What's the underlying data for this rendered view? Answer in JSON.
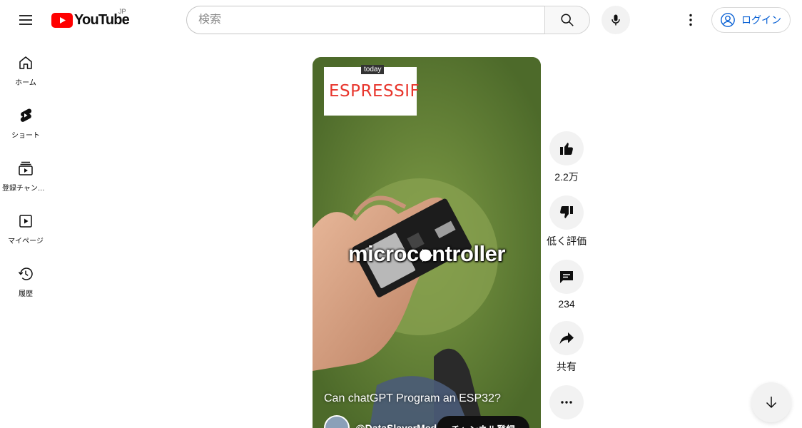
{
  "header": {
    "logo_text": "YouTube",
    "region": "JP",
    "search_placeholder": "検索",
    "login_label": "ログイン"
  },
  "sidebar": {
    "items": [
      {
        "label": "ホーム",
        "icon": "home-icon"
      },
      {
        "label": "ショート",
        "icon": "shorts-icon"
      },
      {
        "label": "登録チャンネル",
        "icon": "subscriptions-icon"
      },
      {
        "label": "マイページ",
        "icon": "library-icon"
      },
      {
        "label": "履歴",
        "icon": "history-icon"
      }
    ]
  },
  "short": {
    "badge": "today",
    "brand_logo_text": "ESPRESSIF",
    "overlay_caption": "microcontroller",
    "title": "Can chatGPT Program an ESP32?",
    "channel": "@DataSlayerMedi",
    "subscribe_label": "チャンネル登録"
  },
  "actions": {
    "like_count": "2.2万",
    "dislike_label": "低く評価",
    "comment_count": "234",
    "share_label": "共有"
  },
  "colors": {
    "brand_red": "#ff0000",
    "link_blue": "#065fd4",
    "espressif_red": "#e8362d"
  }
}
